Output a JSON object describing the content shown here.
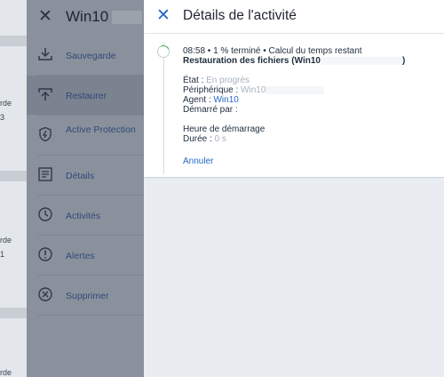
{
  "background": {
    "fragments": [
      "rde",
      "3",
      "rde",
      "1",
      "rde",
      "rde"
    ]
  },
  "machine_panel": {
    "title": "Win10",
    "items": [
      {
        "label": "Sauvegarde",
        "icon": "backup-icon"
      },
      {
        "label": "Restaurer",
        "icon": "restore-icon",
        "active": true
      },
      {
        "label": "Active Protection",
        "icon": "shield-icon"
      },
      {
        "label": "Détails",
        "icon": "details-icon"
      },
      {
        "label": "Activités",
        "icon": "clock-icon"
      },
      {
        "label": "Alertes",
        "icon": "alert-icon"
      },
      {
        "label": "Supprimer",
        "icon": "delete-icon"
      }
    ]
  },
  "details": {
    "title": "Détails de l'activité",
    "activity": {
      "summary": "08:58 • 1 % terminé • Calcul du temps restant",
      "name_prefix": "Restauration des fichiers (Win10",
      "name_suffix": ")",
      "state_label": "État : ",
      "state_value": "En progrès",
      "device_label": "Périphérique : ",
      "device_value": "Win10",
      "agent_label": "Agent : ",
      "agent_value": "Win10",
      "started_label": "Démarré par :",
      "start_time_label": "Heure de démarrage",
      "duration_label": "Durée : ",
      "duration_value": "0 s",
      "cancel_label": "Annuler"
    },
    "progress_percent": 1
  },
  "colors": {
    "accent": "#2668c5",
    "progress": "#3fb34f",
    "panel_dim": "#8a919c"
  }
}
